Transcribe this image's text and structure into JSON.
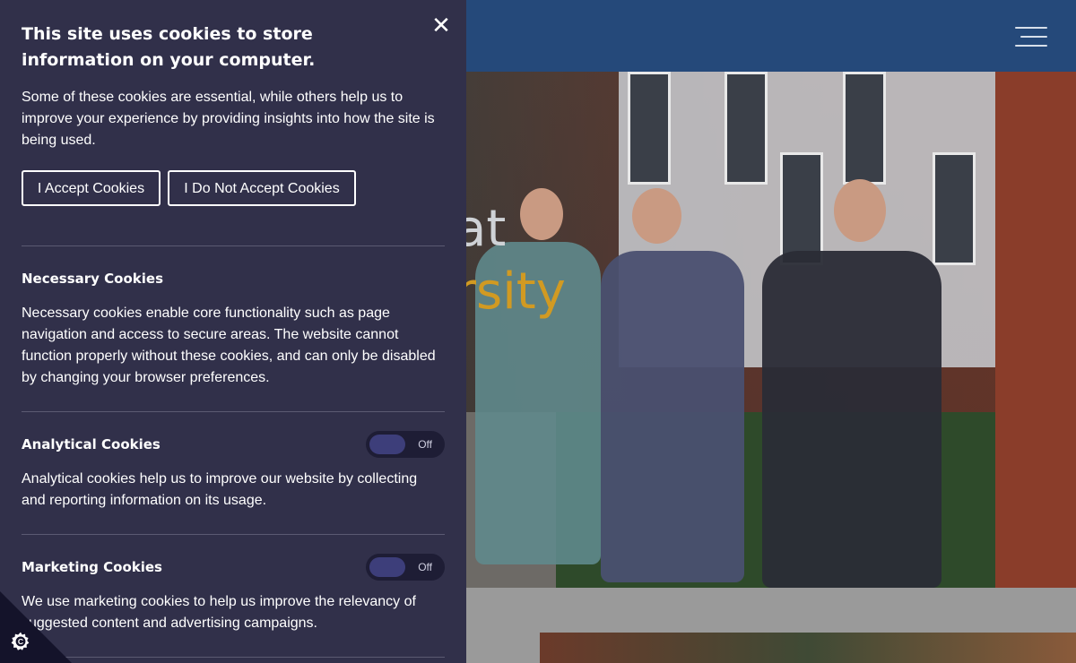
{
  "hero": {
    "text_line1": "at",
    "text_line2": "rsity",
    "text_color1": "#cfd2d6",
    "text_color2": "#d19a22"
  },
  "cookie_panel": {
    "title": "This site uses cookies to store information on your computer.",
    "intro": "Some of these cookies are essential, while others help us to improve your experience by providing insights into how the site is being used.",
    "accept_label": "I Accept Cookies",
    "reject_label": "I Do Not Accept Cookies",
    "close_icon": "close-icon",
    "sections": [
      {
        "title": "Necessary Cookies",
        "text": "Necessary cookies enable core functionality such as page navigation and access to secure areas. The website cannot function properly without these cookies, and can only be disabled by changing your browser preferences."
      },
      {
        "title": "Analytical Cookies",
        "text": "Analytical cookies help us to improve our website by collecting and reporting information on its usage.",
        "toggle_state": "Off"
      },
      {
        "title": "Marketing Cookies",
        "text": "We use marketing cookies to help us improve the relevancy of suggested content and advertising campaigns.",
        "toggle_state": "Off"
      }
    ]
  },
  "colors": {
    "panel_bg": "#31304a",
    "header_bg": "#25497a",
    "toggle_knob": "#3d3e7a"
  }
}
